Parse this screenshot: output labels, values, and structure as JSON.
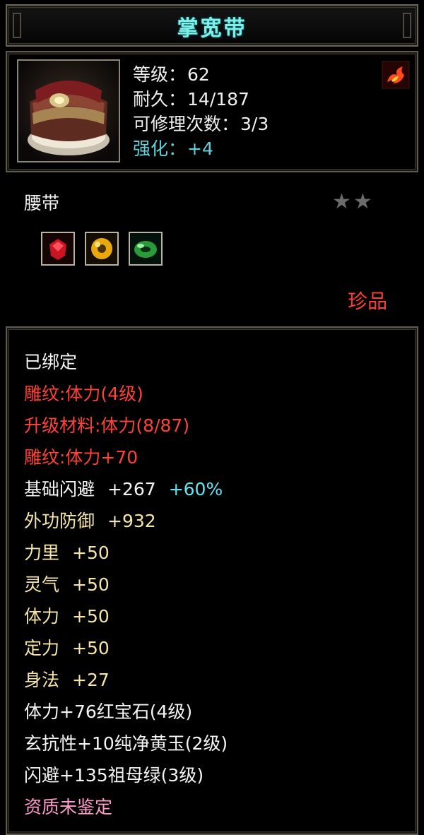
{
  "title": "掌宽带",
  "item": {
    "icon": "belt-icon",
    "stats": [
      {
        "label": "等级：",
        "value": "62"
      },
      {
        "label": "耐久：",
        "value": "14/187"
      },
      {
        "label": "可修理次数：",
        "value": "3/3"
      }
    ],
    "enhance": {
      "label": "强化：",
      "value": "+4"
    },
    "type": "腰带",
    "stars": "★★",
    "rarity": "珍品",
    "gems": [
      "ruby-gem-icon",
      "yellow-jade-icon",
      "emerald-icon"
    ]
  },
  "colors": {
    "title": "#7ef0ec",
    "red": "#ff4136",
    "gold": "#f6e6a6",
    "cyan": "#63e4f0",
    "pink": "#ff9ccc"
  },
  "attributes": {
    "bound": "已绑定",
    "engrave1": "雕纹:体力(4级)",
    "upgrade": "升级材料:体力(8/87)",
    "engrave2": "雕纹:体力+70",
    "dodge": {
      "label": "基础闪避",
      "value": "+267",
      "bonus": "+60%"
    },
    "defense": {
      "label": "外功防御",
      "value": "+932"
    },
    "strength": {
      "label": "力里",
      "value": "+50"
    },
    "spirit": {
      "label": "灵气",
      "value": "+50"
    },
    "stamina": {
      "label": "体力",
      "value": "+50"
    },
    "focus": {
      "label": "定力",
      "value": "+50"
    },
    "agility": {
      "label": "身法",
      "value": "+27"
    },
    "gem1": "体力+76红宝石(4级)",
    "gem2": "玄抗性+10纯净黄玉(2级)",
    "gem3": "闪避+135祖母绿(3级)",
    "quality": "资质未鉴定"
  }
}
